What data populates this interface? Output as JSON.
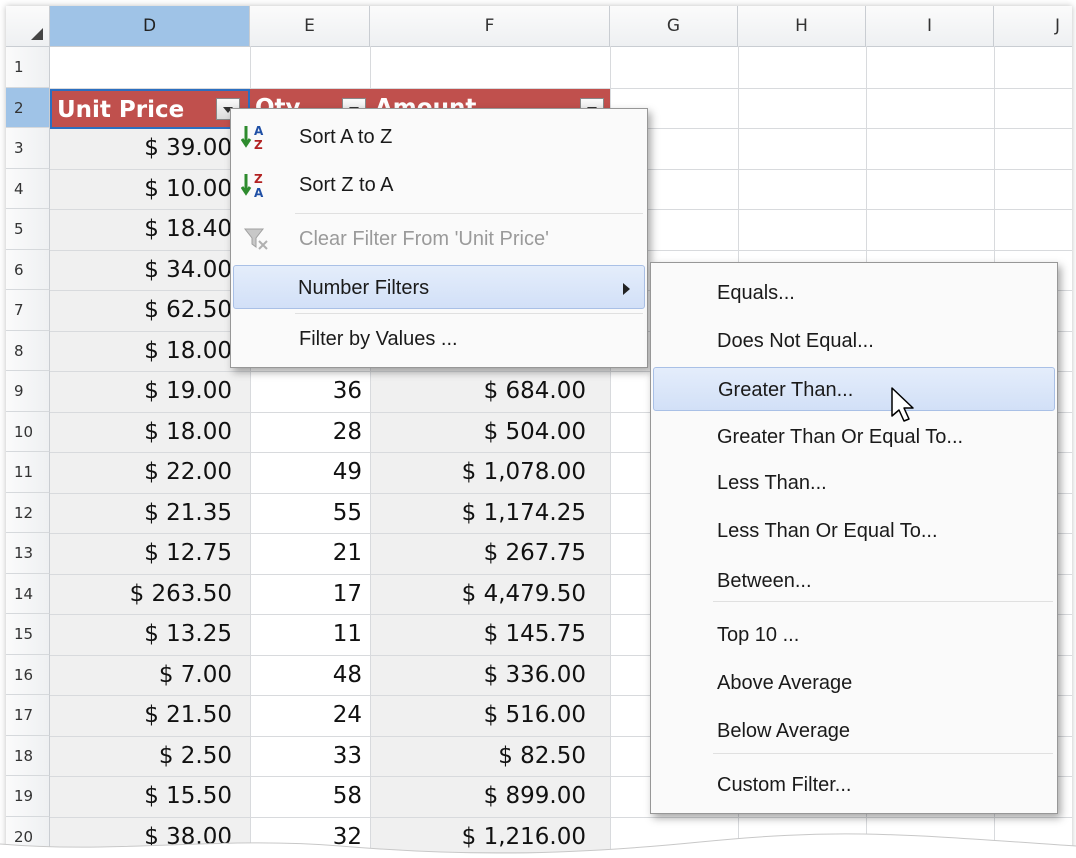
{
  "columns": [
    "D",
    "E",
    "F",
    "G",
    "H",
    "I",
    "J"
  ],
  "rows": [
    "1",
    "2",
    "3",
    "4",
    "5",
    "6",
    "7",
    "8",
    "9",
    "10",
    "11",
    "12",
    "13",
    "14",
    "15",
    "16",
    "17",
    "18",
    "19",
    "20"
  ],
  "headers": {
    "unit_price": "Unit Price",
    "qty": "Qty",
    "amount": "Amount"
  },
  "data": [
    {
      "price": "$ 39.00",
      "qty": "",
      "amount": ""
    },
    {
      "price": "$ 10.00",
      "qty": "",
      "amount": ""
    },
    {
      "price": "$ 18.40",
      "qty": "",
      "amount": ""
    },
    {
      "price": "$ 34.00",
      "qty": "",
      "amount": ""
    },
    {
      "price": "$ 62.50",
      "qty": "",
      "amount": ""
    },
    {
      "price": "$ 18.00",
      "qty": "",
      "amount": ""
    },
    {
      "price": "$ 19.00",
      "qty": "36",
      "amount": "$ 684.00"
    },
    {
      "price": "$ 18.00",
      "qty": "28",
      "amount": "$ 504.00"
    },
    {
      "price": "$ 22.00",
      "qty": "49",
      "amount": "$ 1,078.00"
    },
    {
      "price": "$ 21.35",
      "qty": "55",
      "amount": "$ 1,174.25"
    },
    {
      "price": "$ 12.75",
      "qty": "21",
      "amount": "$ 267.75"
    },
    {
      "price": "$ 263.50",
      "qty": "17",
      "amount": "$ 4,479.50"
    },
    {
      "price": "$ 13.25",
      "qty": "11",
      "amount": "$ 145.75"
    },
    {
      "price": "$ 7.00",
      "qty": "48",
      "amount": "$ 336.00"
    },
    {
      "price": "$ 21.50",
      "qty": "24",
      "amount": "$ 516.00"
    },
    {
      "price": "$ 2.50",
      "qty": "33",
      "amount": "$ 82.50"
    },
    {
      "price": "$ 15.50",
      "qty": "58",
      "amount": "$ 899.00"
    },
    {
      "price": "$ 38.00",
      "qty": "32",
      "amount": "$ 1,216.00"
    }
  ],
  "context_menu": {
    "sort_az": "Sort A to Z",
    "sort_za": "Sort Z to A",
    "clear_filter": "Clear Filter From 'Unit Price'",
    "number_filters": "Number Filters",
    "filter_by_values": "Filter by Values ..."
  },
  "submenu": [
    "Equals...",
    "Does Not Equal...",
    "Greater Than...",
    "Greater Than Or Equal To...",
    "Less Than...",
    "Less Than Or Equal To...",
    "Between...",
    "Top 10 ...",
    "Above Average",
    "Below Average",
    "Custom Filter..."
  ],
  "colors": {
    "header_fill": "#c0504d",
    "selection": "#9fc3e7",
    "highlight": "#d2e0f7"
  }
}
